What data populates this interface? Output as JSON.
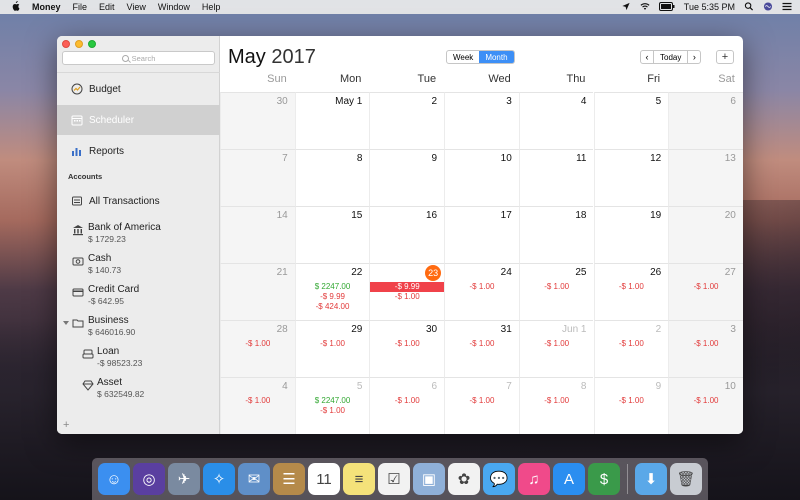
{
  "menubar": {
    "app_name": "Money",
    "items": [
      "File",
      "Edit",
      "View",
      "Window",
      "Help"
    ],
    "clock": "Tue 5:35 PM"
  },
  "sidebar": {
    "search_placeholder": "Search",
    "nav": [
      {
        "label": "Budget",
        "icon": "budget-icon"
      },
      {
        "label": "Scheduler",
        "icon": "calendar-icon",
        "selected": true
      },
      {
        "label": "Reports",
        "icon": "bar-chart-icon"
      }
    ],
    "accounts_header": "Accounts",
    "all_transactions": "All Transactions",
    "accounts": [
      {
        "name": "Bank of America",
        "amount": "$ 1729.23",
        "icon": "bank-icon"
      },
      {
        "name": "Cash",
        "amount": "$ 140.73",
        "icon": "cash-icon"
      },
      {
        "name": "Credit Card",
        "amount": "-$ 642.95",
        "icon": "credit-card-icon"
      },
      {
        "name": "Business",
        "amount": "$ 646016.90",
        "icon": "bank-icon",
        "group": true
      },
      {
        "name": "Loan",
        "amount": "-$ 98523.23",
        "icon": "loan-icon",
        "child": true
      },
      {
        "name": "Asset",
        "amount": "$ 632549.82",
        "icon": "diamond-icon",
        "child": true
      }
    ],
    "add_label": "+"
  },
  "header": {
    "month": "May",
    "year": "2017",
    "views": [
      "Week",
      "Month"
    ],
    "active_view": "Month",
    "prev": "‹",
    "today": "Today",
    "next": "›",
    "add": "+"
  },
  "weekdays": [
    "Sun",
    "Mon",
    "Tue",
    "Wed",
    "Thu",
    "Fri",
    "Sat"
  ],
  "calendar": [
    [
      {
        "d": "30",
        "other": true,
        "txs": []
      },
      {
        "d": "May 1",
        "txs": []
      },
      {
        "d": "2",
        "txs": []
      },
      {
        "d": "3",
        "txs": []
      },
      {
        "d": "4",
        "txs": []
      },
      {
        "d": "5",
        "txs": []
      },
      {
        "d": "6",
        "txs": []
      }
    ],
    [
      {
        "d": "7",
        "txs": []
      },
      {
        "d": "8",
        "txs": []
      },
      {
        "d": "9",
        "txs": []
      },
      {
        "d": "10",
        "txs": []
      },
      {
        "d": "11",
        "txs": []
      },
      {
        "d": "12",
        "txs": []
      },
      {
        "d": "13",
        "txs": []
      }
    ],
    [
      {
        "d": "14",
        "txs": []
      },
      {
        "d": "15",
        "txs": []
      },
      {
        "d": "16",
        "txs": []
      },
      {
        "d": "17",
        "txs": []
      },
      {
        "d": "18",
        "txs": []
      },
      {
        "d": "19",
        "txs": []
      },
      {
        "d": "20",
        "txs": []
      }
    ],
    [
      {
        "d": "21",
        "txs": []
      },
      {
        "d": "22",
        "txs": [
          {
            "t": "$ 2247.00",
            "k": "pos"
          },
          {
            "t": "-$ 9.99",
            "k": "neg"
          },
          {
            "t": "-$ 424.00",
            "k": "neg"
          }
        ]
      },
      {
        "d": "23",
        "today": true,
        "txs": [
          {
            "t": "-$ 9.99",
            "k": "hl"
          },
          {
            "t": "-$ 1.00",
            "k": "neg"
          }
        ]
      },
      {
        "d": "24",
        "txs": [
          {
            "t": "-$ 1.00",
            "k": "neg"
          }
        ]
      },
      {
        "d": "25",
        "txs": [
          {
            "t": "-$ 1.00",
            "k": "neg"
          }
        ]
      },
      {
        "d": "26",
        "txs": [
          {
            "t": "-$ 1.00",
            "k": "neg"
          }
        ]
      },
      {
        "d": "27",
        "txs": [
          {
            "t": "-$ 1.00",
            "k": "neg"
          }
        ]
      }
    ],
    [
      {
        "d": "28",
        "txs": [
          {
            "t": "-$ 1.00",
            "k": "neg"
          }
        ]
      },
      {
        "d": "29",
        "txs": [
          {
            "t": "-$ 1.00",
            "k": "neg"
          }
        ]
      },
      {
        "d": "30",
        "txs": [
          {
            "t": "-$ 1.00",
            "k": "neg"
          }
        ]
      },
      {
        "d": "31",
        "txs": [
          {
            "t": "-$ 1.00",
            "k": "neg"
          }
        ]
      },
      {
        "d": "Jun 1",
        "other": true,
        "txs": [
          {
            "t": "-$ 1.00",
            "k": "neg"
          }
        ]
      },
      {
        "d": "2",
        "other": true,
        "txs": [
          {
            "t": "-$ 1.00",
            "k": "neg"
          }
        ]
      },
      {
        "d": "3",
        "other": true,
        "txs": [
          {
            "t": "-$ 1.00",
            "k": "neg"
          }
        ]
      }
    ],
    [
      {
        "d": "4",
        "other": true,
        "txs": [
          {
            "t": "-$ 1.00",
            "k": "neg"
          }
        ]
      },
      {
        "d": "5",
        "other": true,
        "txs": [
          {
            "t": "$ 2247.00",
            "k": "pos"
          },
          {
            "t": "-$ 1.00",
            "k": "neg"
          }
        ]
      },
      {
        "d": "6",
        "other": true,
        "txs": [
          {
            "t": "-$ 1.00",
            "k": "neg"
          }
        ]
      },
      {
        "d": "7",
        "other": true,
        "txs": [
          {
            "t": "-$ 1.00",
            "k": "neg"
          }
        ]
      },
      {
        "d": "8",
        "other": true,
        "txs": [
          {
            "t": "-$ 1.00",
            "k": "neg"
          }
        ]
      },
      {
        "d": "9",
        "other": true,
        "txs": [
          {
            "t": "-$ 1.00",
            "k": "neg"
          }
        ]
      },
      {
        "d": "10",
        "other": true,
        "txs": [
          {
            "t": "-$ 1.00",
            "k": "neg"
          }
        ]
      }
    ]
  ],
  "calendar_day_badge": "11",
  "dock": [
    {
      "name": "finder-icon",
      "color": "#3b8ff0",
      "glyph": "☺"
    },
    {
      "name": "siri-icon",
      "color": "#5a3fa0",
      "glyph": "◎"
    },
    {
      "name": "launchpad-icon",
      "color": "#7a8aa0",
      "glyph": "✈"
    },
    {
      "name": "safari-icon",
      "color": "#2a8ee8",
      "glyph": "✧"
    },
    {
      "name": "mail-stamp-icon",
      "color": "#5f8fc8",
      "glyph": "✉"
    },
    {
      "name": "contacts-icon",
      "color": "#b58a4a",
      "glyph": "☰"
    },
    {
      "name": "calendar-app-icon",
      "color": "#ffffff",
      "glyph": "11"
    },
    {
      "name": "notes-icon",
      "color": "#f4e27a",
      "glyph": "≡"
    },
    {
      "name": "reminders-icon",
      "color": "#f2f2f2",
      "glyph": "☑"
    },
    {
      "name": "preview-icon",
      "color": "#8fb0d8",
      "glyph": "▣"
    },
    {
      "name": "photos-icon",
      "color": "#f2f2f2",
      "glyph": "✿"
    },
    {
      "name": "messages-icon",
      "color": "#4aa8f0",
      "glyph": "💬"
    },
    {
      "name": "itunes-icon",
      "color": "#f04a8a",
      "glyph": "♫"
    },
    {
      "name": "app-store-icon",
      "color": "#2a8ef0",
      "glyph": "A"
    },
    {
      "name": "money-app-icon",
      "color": "#3a9a4a",
      "glyph": "$"
    },
    {
      "name": "downloads-icon",
      "color": "#5aa8e8",
      "glyph": "⬇"
    },
    {
      "name": "trash-icon",
      "color": "#c8ccd2",
      "glyph": "🗑"
    }
  ]
}
